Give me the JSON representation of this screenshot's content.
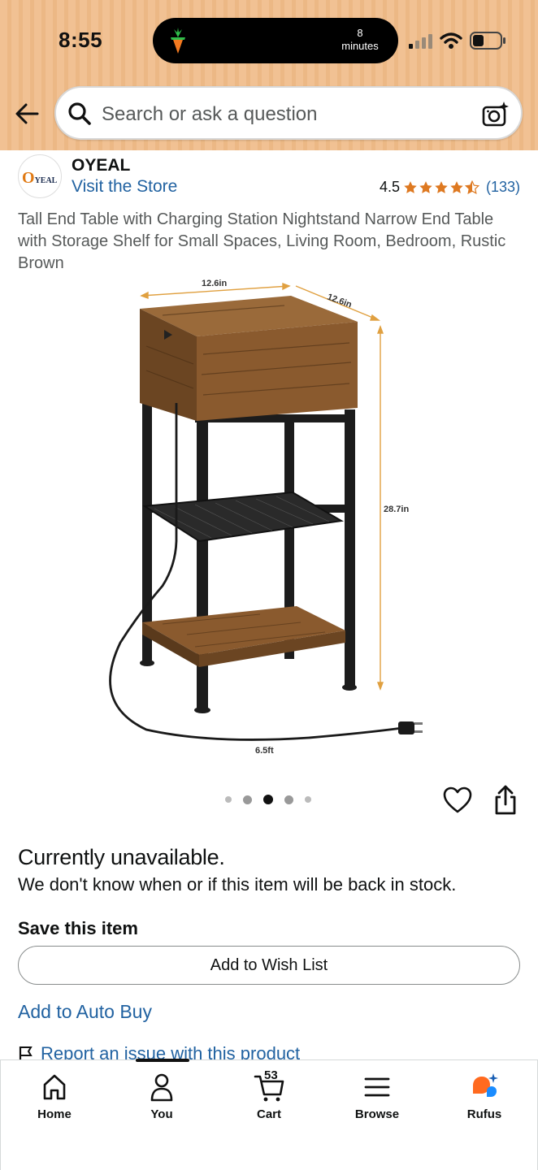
{
  "status_bar": {
    "time": "8:55",
    "activity_value": "8",
    "activity_unit": "minutes"
  },
  "search": {
    "placeholder": "Search or ask a question"
  },
  "brand": {
    "logo_text": "YEAL",
    "logo_initial": "O",
    "name": "OYEAL",
    "visit_store": "Visit the Store"
  },
  "rating": {
    "value": "4.5",
    "stars": 4.5,
    "count": "(133)",
    "star_color": "#de7921"
  },
  "product": {
    "title": "Tall End Table with Charging Station Nightstand Narrow End Table with Storage Shelf for Small Spaces, Living Room, Bedroom, Rustic Brown",
    "dim_width": "12.6in",
    "dim_depth": "12.6in",
    "dim_height": "28.7in",
    "dim_cord": "6.5ft"
  },
  "gallery": {
    "total_dots": 5,
    "active_index": 2
  },
  "availability": {
    "heading": "Currently unavailable.",
    "message": "We don't know when or if this item will be back in stock."
  },
  "save": {
    "heading": "Save this item",
    "wish_button": "Add to Wish List",
    "auto_buy": "Add to Auto Buy",
    "report": "Report an issue with this product"
  },
  "bottom_nav": {
    "home": "Home",
    "you": "You",
    "cart": "Cart",
    "cart_count": "53",
    "browse": "Browse",
    "rufus": "Rufus"
  },
  "colors": {
    "header_bg": "#f1c193",
    "link": "#2162a1",
    "text": "#0f1111"
  }
}
